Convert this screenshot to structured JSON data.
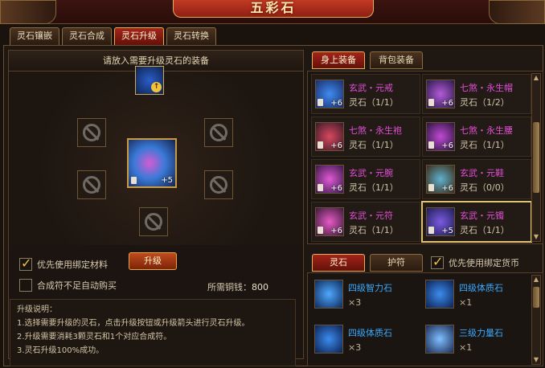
{
  "window": {
    "title": "五彩石"
  },
  "tabs": [
    {
      "label": "灵石镶嵌",
      "active": false
    },
    {
      "label": "灵石合成",
      "active": false
    },
    {
      "label": "灵石升级",
      "active": true
    },
    {
      "label": "灵石转换",
      "active": false
    }
  ],
  "upgrade": {
    "header": "请放入需要升级灵石的装备",
    "center_item_level": "+5",
    "option_bound": "优先使用绑定材料",
    "option_autobuy": "合成符不足自动购买",
    "button": "升级",
    "cost_label": "所需铜钱：",
    "cost_value": "800",
    "desc_title": "升级说明：",
    "desc_lines": [
      "1.选择需要升级的灵石，点击升级按钮或升级箭头进行灵石升级。",
      "2.升级需要消耗3颗灵石和1个对应合成符。",
      "3.灵石升级100%成功。"
    ]
  },
  "equip_tabs": [
    {
      "label": "身上装备",
      "active": true
    },
    {
      "label": "背包装备",
      "active": false
    }
  ],
  "equipment": [
    {
      "name": "玄武・元戒",
      "sub": "灵石（1/1）",
      "level": "+6",
      "color": "#e24fd8"
    },
    {
      "name": "七煞・永生帽",
      "sub": "灵石（1/2）",
      "level": "+6",
      "color": "#e24fd8"
    },
    {
      "name": "七煞・永生袍",
      "sub": "灵石（1/1）",
      "level": "+6",
      "color": "#e24fd8"
    },
    {
      "name": "七煞・永生腰",
      "sub": "灵石（1/1）",
      "level": "+6",
      "color": "#e24fd8"
    },
    {
      "name": "玄武・元腕",
      "sub": "灵石（1/1）",
      "level": "+6",
      "color": "#e24fd8"
    },
    {
      "name": "玄武・元鞋",
      "sub": "灵石（0/0）",
      "level": "+6",
      "color": "#e24fd8"
    },
    {
      "name": "玄武・元符",
      "sub": "灵石（1/1）",
      "level": "+6",
      "color": "#e24fd8"
    },
    {
      "name": "玄武・元镯",
      "sub": "灵石（1/1）",
      "level": "+5",
      "color": "#e24fd8",
      "selected": true
    }
  ],
  "stone_tabs": [
    {
      "label": "灵石",
      "active": true
    },
    {
      "label": "护符",
      "active": false
    }
  ],
  "stone_option": "优先使用绑定货币",
  "stones": [
    {
      "name": "四级智力石",
      "count": "×3"
    },
    {
      "name": "四级体质石",
      "count": "×1"
    },
    {
      "name": "四级体质石",
      "count": "×3"
    },
    {
      "name": "三级力量石",
      "count": "×1"
    }
  ]
}
